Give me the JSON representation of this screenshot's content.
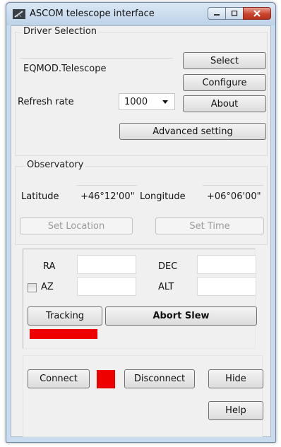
{
  "window": {
    "title": "ASCOM telescope interface"
  },
  "driver": {
    "group_label": "Driver Selection",
    "name": "EQMOD.Telescope",
    "select_label": "Select",
    "configure_label": "Configure",
    "about_label": "About",
    "refresh_label": "Refresh rate",
    "refresh_value": "1000",
    "advanced_label": "Advanced setting"
  },
  "observatory": {
    "group_label": "Observatory",
    "latitude_label": "Latitude",
    "latitude_value": "+46°12'00\"",
    "longitude_label": "Longitude",
    "longitude_value": "+06°06'00\"",
    "set_location_label": "Set Location",
    "set_time_label": "Set Time"
  },
  "coords": {
    "ra_label": "RA",
    "ra_value": "",
    "dec_label": "DEC",
    "dec_value": "",
    "az_label": "AZ",
    "az_value": "",
    "az_checked": false,
    "alt_label": "ALT",
    "alt_value": "",
    "tracking_label": "Tracking",
    "abort_label": "Abort Slew",
    "tracking_status_color": "#ee0000"
  },
  "connection": {
    "connect_label": "Connect",
    "status_color": "#ee0000",
    "disconnect_label": "Disconnect",
    "hide_label": "Hide",
    "help_label": "Help"
  }
}
